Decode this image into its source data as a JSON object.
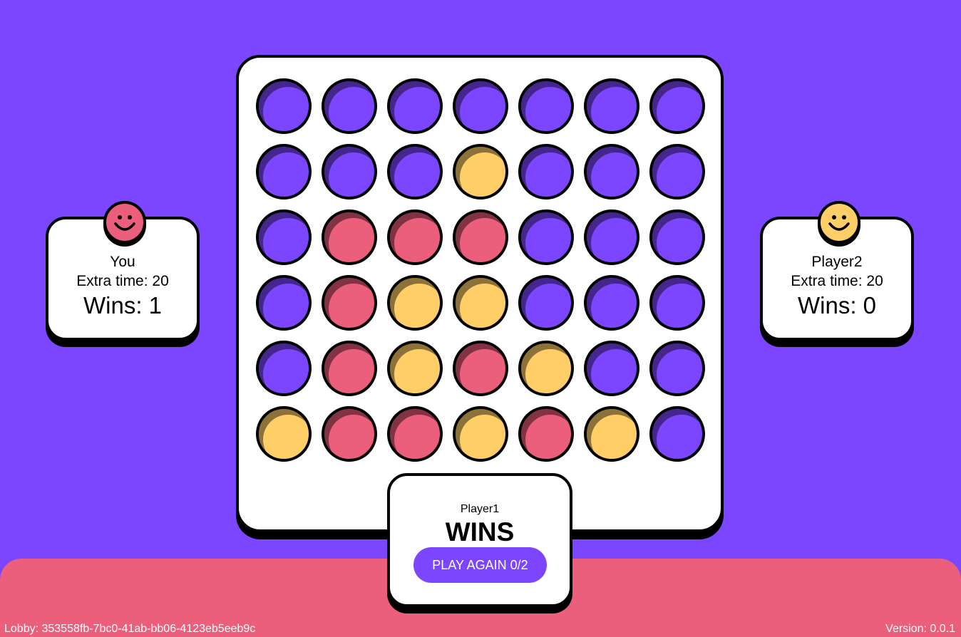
{
  "colors": {
    "background": "#7c45ff",
    "floor": "#eb5e7c",
    "player1_disc": "#eb5e7c",
    "player2_disc": "#ffce67",
    "empty_slot": "#7c45ff"
  },
  "board": {
    "columns": 7,
    "rows": 6,
    "cells": [
      [
        "empty",
        "empty",
        "empty",
        "empty",
        "empty",
        "empty",
        "empty"
      ],
      [
        "empty",
        "empty",
        "empty",
        "yellow",
        "empty",
        "empty",
        "empty"
      ],
      [
        "empty",
        "red",
        "red",
        "red",
        "empty",
        "empty",
        "empty"
      ],
      [
        "empty",
        "red",
        "yellow",
        "yellow",
        "empty",
        "empty",
        "empty"
      ],
      [
        "empty",
        "red",
        "yellow",
        "red",
        "yellow",
        "empty",
        "empty"
      ],
      [
        "yellow",
        "red",
        "red",
        "yellow",
        "red",
        "yellow",
        "empty"
      ]
    ]
  },
  "players": {
    "left": {
      "name": "You",
      "extra_time": "Extra time: 20",
      "wins": "Wins: 1",
      "avatar_icon": "smiley-face-icon",
      "avatar_color": "#eb5e7c"
    },
    "right": {
      "name": "Player2",
      "extra_time": "Extra time: 20",
      "wins": "Wins: 0",
      "avatar_icon": "smiley-face-icon",
      "avatar_color": "#ffce67"
    }
  },
  "result": {
    "winner_name": "Player1",
    "wins_label": "WINS",
    "play_again_label": "PLAY AGAIN 0/2"
  },
  "footer": {
    "lobby": "Lobby: 353558fb-7bc0-41ab-bb06-4123eb5eeb9c",
    "version": "Version: 0.0.1"
  }
}
